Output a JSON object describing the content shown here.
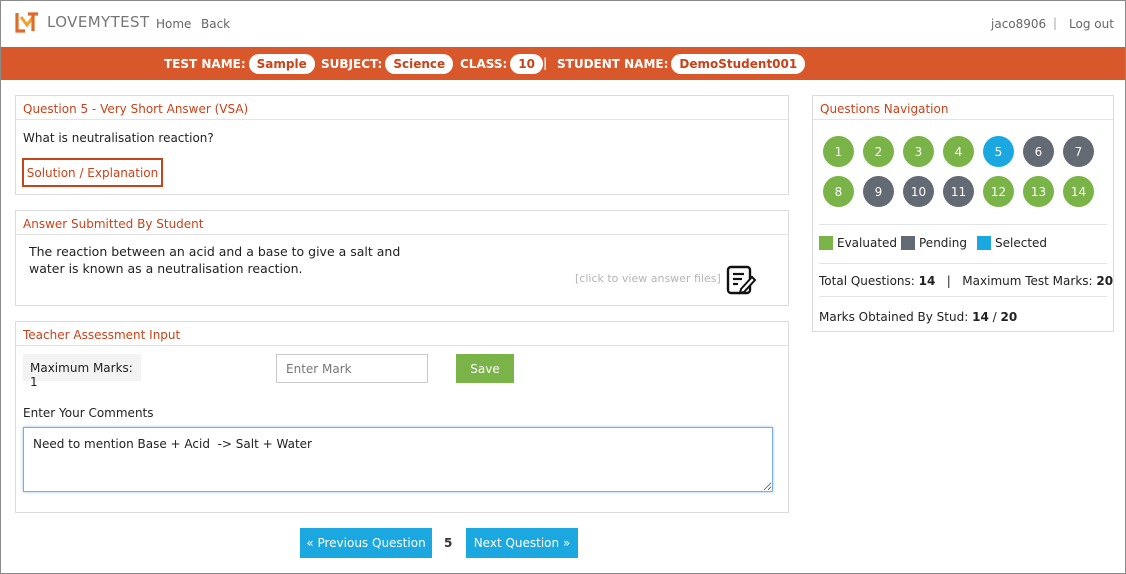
{
  "app": {
    "brand": "LOVEMYTEST",
    "nav": {
      "home": "Home",
      "back": "Back"
    },
    "user": {
      "username": "jaco8906",
      "separator": "|",
      "logout": "Log out"
    }
  },
  "infobar": {
    "test_label": "TEST NAME:",
    "test_value": "Sample",
    "subject_label": "SUBJECT:",
    "subject_value": "Science",
    "class_label": "CLASS:",
    "class_value": "10",
    "student_label": "STUDENT NAME:",
    "student_value": "DemoStudent001",
    "separator": "|"
  },
  "question": {
    "heading": "Question 5 - Very Short Answer (VSA)",
    "text": "What is neutralisation reaction?",
    "solution_button": "Solution / Explanation"
  },
  "answer": {
    "heading": "Answer Submitted By Student",
    "text": "The reaction between an acid and a base to give a salt and water is known as a neutralisation reaction.",
    "files_link": "[click to view answer files]",
    "icon": "edit-note-icon"
  },
  "assessment": {
    "heading": "Teacher Assessment Input",
    "max_marks": "Maximum Marks: 1",
    "mark_placeholder": "Enter Mark",
    "save_label": "Save",
    "comments_label": "Enter Your Comments",
    "comments_value": "Need to mention Base + Acid  -> Salt + Water"
  },
  "pagination": {
    "prev_label": "« Previous Question",
    "current": "5",
    "next_label": "Next Question »"
  },
  "navigation": {
    "heading": "Questions Navigation",
    "questions": [
      {
        "n": "1",
        "status": "evaluated"
      },
      {
        "n": "2",
        "status": "evaluated"
      },
      {
        "n": "3",
        "status": "evaluated"
      },
      {
        "n": "4",
        "status": "evaluated"
      },
      {
        "n": "5",
        "status": "selected"
      },
      {
        "n": "6",
        "status": "pending"
      },
      {
        "n": "7",
        "status": "pending"
      },
      {
        "n": "8",
        "status": "evaluated"
      },
      {
        "n": "9",
        "status": "pending"
      },
      {
        "n": "10",
        "status": "pending"
      },
      {
        "n": "11",
        "status": "pending"
      },
      {
        "n": "12",
        "status": "evaluated"
      },
      {
        "n": "13",
        "status": "evaluated"
      },
      {
        "n": "14",
        "status": "evaluated"
      }
    ],
    "legend": {
      "evaluated": "Evaluated",
      "pending": "Pending",
      "selected": "Selected"
    },
    "total_questions_label": "Total Questions:",
    "total_questions": "14",
    "stats_separator": "|",
    "max_test_marks_label": "Maximum Test Marks:",
    "max_test_marks": "20",
    "marks_obtained_label": "Marks Obtained By Stud:",
    "marks_obtained": "14",
    "marks_slash": "/",
    "marks_total": "20"
  },
  "colors": {
    "brand_orange": "#d9582b",
    "accent_red": "#c8421a",
    "evaluated": "#7ab347",
    "pending": "#636a73",
    "selected": "#1ba8e0"
  }
}
